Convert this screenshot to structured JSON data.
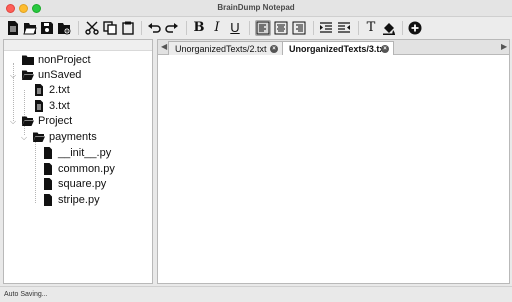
{
  "window": {
    "title": "BrainDump Notepad"
  },
  "toolbar": {
    "buttons": [
      "new-file-icon",
      "open-folder-icon",
      "save-icon",
      "save-all-icon",
      "cut-icon",
      "copy-icon",
      "paste-icon",
      "undo-icon",
      "redo-icon",
      "bold-icon",
      "italic-icon",
      "underline-icon",
      "align-left-icon",
      "align-center-icon",
      "align-right-icon",
      "indent-icon",
      "outdent-icon",
      "font-icon",
      "fill-color-icon",
      "add-icon"
    ],
    "bold_label": "B",
    "italic_label": "I",
    "underline_label": "U",
    "font_label": "T"
  },
  "tree": [
    {
      "label": "nonProject",
      "type": "folder-closed",
      "depth": 0
    },
    {
      "label": "unSaved",
      "type": "folder-open",
      "depth": 0
    },
    {
      "label": "2.txt",
      "type": "file",
      "depth": 1
    },
    {
      "label": "3.txt",
      "type": "file",
      "depth": 1
    },
    {
      "label": "Project",
      "type": "folder-open",
      "depth": 0
    },
    {
      "label": "payments",
      "type": "folder-open",
      "depth": 1
    },
    {
      "label": "__init__.py",
      "type": "file",
      "depth": 2
    },
    {
      "label": "common.py",
      "type": "file",
      "depth": 2
    },
    {
      "label": "square.py",
      "type": "file",
      "depth": 2
    },
    {
      "label": "stripe.py",
      "type": "file",
      "depth": 2
    }
  ],
  "tabs": [
    {
      "label": "UnorganizedTexts/2.txt",
      "active": false
    },
    {
      "label": "UnorganizedTexts/3.txt",
      "active": true
    }
  ],
  "editor": {
    "content": ""
  },
  "status": {
    "text": "Auto Saving..."
  }
}
